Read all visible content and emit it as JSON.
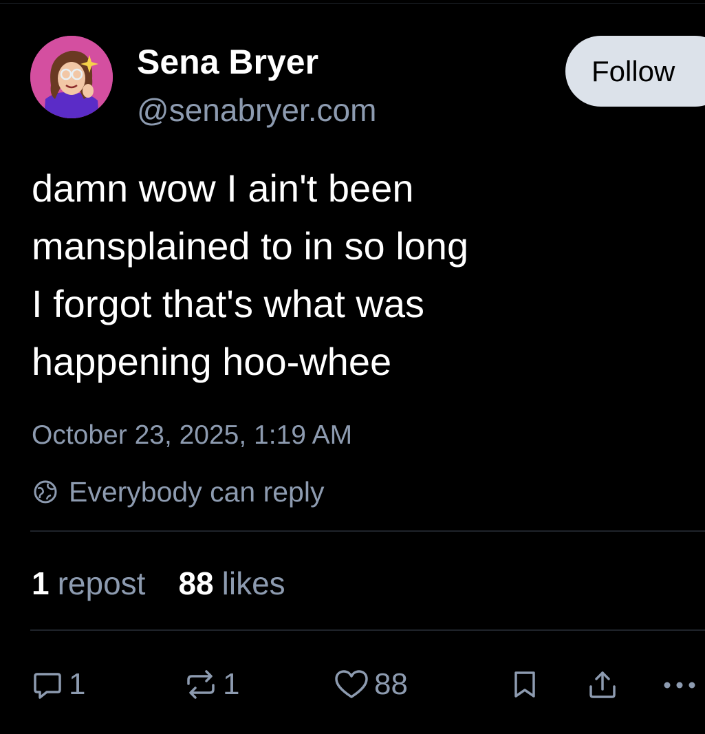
{
  "post": {
    "author": {
      "display_name": "Sena Bryer",
      "handle": "@senabryer.com"
    },
    "follow_label": "Follow",
    "text_lines": [
      "damn wow I ain't been",
      "mansplained to in so long",
      "I forgot that's what was",
      "happening hoo-whee"
    ],
    "timestamp": "October 23, 2025, 1:19 AM",
    "reply_setting": "Everybody can reply",
    "stats": {
      "reposts_count": "1",
      "reposts_label": "repost",
      "likes_count": "88",
      "likes_label": "likes"
    },
    "actions": {
      "reply_count": "1",
      "repost_count": "1",
      "like_count": "88"
    },
    "icons": [
      "reply-icon",
      "repost-icon",
      "heart-icon",
      "bookmark-icon",
      "share-icon",
      "more-icon",
      "globe-icon"
    ]
  },
  "colors": {
    "background": "#000000",
    "text": "#ffffff",
    "muted": "#8d9bb0",
    "follow_bg": "#dce2ea",
    "divider": "#1f242b"
  }
}
